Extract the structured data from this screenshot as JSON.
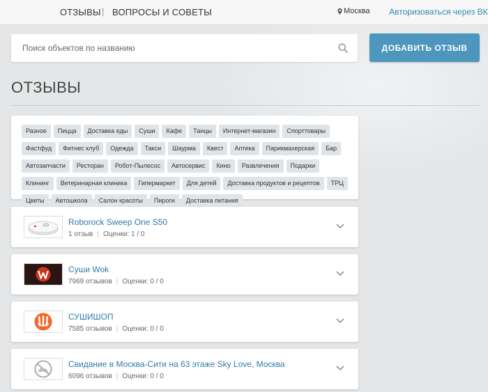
{
  "nav": {
    "reviews": "ОТЗЫВЫ",
    "separator": "|",
    "questions": "ВОПРОСЫ И СОВЕТЫ",
    "city": "Москва",
    "auth": "Авторизоваться через ВК"
  },
  "search": {
    "placeholder": "Поиск объектов по названию"
  },
  "add_button": "ДОБАВИТЬ ОТЗЫВ",
  "page_title": "ОТЗЫВЫ",
  "tags": [
    "Разное",
    "Пицца",
    "Доставка еды",
    "Суши",
    "Кафе",
    "Танцы",
    "Интернет-магазин",
    "Спорттовары",
    "Фастфуд",
    "Фитнес клуб",
    "Одежда",
    "Такси",
    "Шаурма",
    "Квест",
    "Аптека",
    "Парикмахерская",
    "Бар",
    "Автозапчасти",
    "Ресторан",
    "Робот-Пылесос",
    "Автосервис",
    "Кино",
    "Развлечения",
    "Подарки",
    "Клининг",
    "Ветеринарная клиника",
    "Гипермаркет",
    "Для детей",
    "Доставка продуктов и рецептов",
    "ТРЦ",
    "Цветы",
    "Автошкола",
    "Салон красоты",
    "Пироги",
    "Доставка питания"
  ],
  "listings": [
    {
      "title": "Roborock Sweep One S50",
      "reviews": "1 отзыв",
      "rating_label": "Оценки:",
      "rating_value": "1",
      "rating_total": "/ 0",
      "thumb_icon": "robot-vacuum-icon"
    },
    {
      "title": "Суши Wok",
      "reviews": "7969 отзывов",
      "rating_label": "Оценки:",
      "rating_value": "0",
      "rating_total": "/ 0",
      "thumb_icon": "sushi-wok-logo"
    },
    {
      "title": "СУШИШОП",
      "reviews": "7585 отзывов",
      "rating_label": "Оценки:",
      "rating_value": "0",
      "rating_total": "/ 0",
      "thumb_icon": "sushishop-logo"
    },
    {
      "title": "Свидание в Москва-Сити на 63 этаже Sky Love, Москва",
      "reviews": "6096 отзывов",
      "rating_label": "Оценки:",
      "rating_value": "0",
      "rating_total": "/ 0",
      "thumb_icon": "no-image-icon"
    }
  ],
  "colors": {
    "accent": "#4d96bd",
    "link": "#2e7aa8",
    "tag_bg": "#dfe4e8"
  }
}
